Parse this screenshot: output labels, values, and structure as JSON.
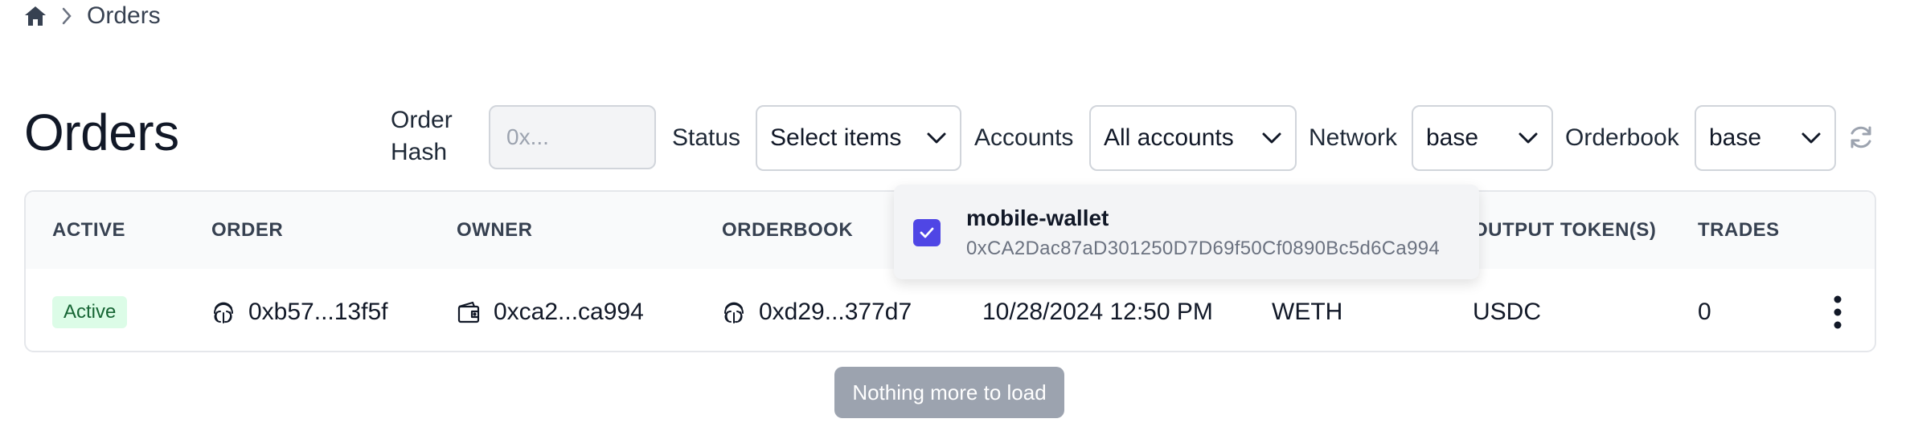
{
  "breadcrumb": {
    "current": "Orders"
  },
  "page_title": "Orders",
  "filters": {
    "order_hash_label_line1": "Order",
    "order_hash_label_line2": "Hash",
    "order_hash_placeholder": "0x...",
    "status_label": "Status",
    "status_value": "Select items",
    "accounts_label": "Accounts",
    "accounts_value": "All accounts",
    "network_label": "Network",
    "network_value": "base",
    "orderbook_label": "Orderbook",
    "orderbook_value": "base"
  },
  "table": {
    "headers": {
      "active": "ACTIVE",
      "order": "ORDER",
      "owner": "OWNER",
      "orderbook": "ORDERBOOK",
      "output_tokens": "OUTPUT TOKEN(S)",
      "trades": "TRADES"
    },
    "rows": [
      {
        "status": "Active",
        "order": "0xb57...13f5f",
        "owner": "0xca2...ca994",
        "orderbook": "0xd29...377d7",
        "created": "10/28/2024 12:50 PM",
        "input_token": "WETH",
        "output_token": "USDC",
        "trades": "0"
      }
    ]
  },
  "load_more_label": "Nothing more to load",
  "accounts_dropdown": {
    "items": [
      {
        "name": "mobile-wallet",
        "address": "0xCA2Dac87aD301250D7D69f50Cf0890Bc5d6Ca994",
        "checked": true
      }
    ]
  },
  "colors": {
    "accent": "#4f46e5",
    "active_badge_bg": "#dcfce7",
    "active_badge_text": "#166534",
    "disabled_button": "#9ca3af"
  },
  "icons": {
    "home": "home-icon",
    "chevron": "chevron-right-icon",
    "select_caret": "chevron-down-icon",
    "refresh": "refresh-icon",
    "fingerprint": "fingerprint-icon",
    "wallet": "wallet-icon",
    "kebab": "kebab-menu-icon",
    "check": "check-icon"
  }
}
